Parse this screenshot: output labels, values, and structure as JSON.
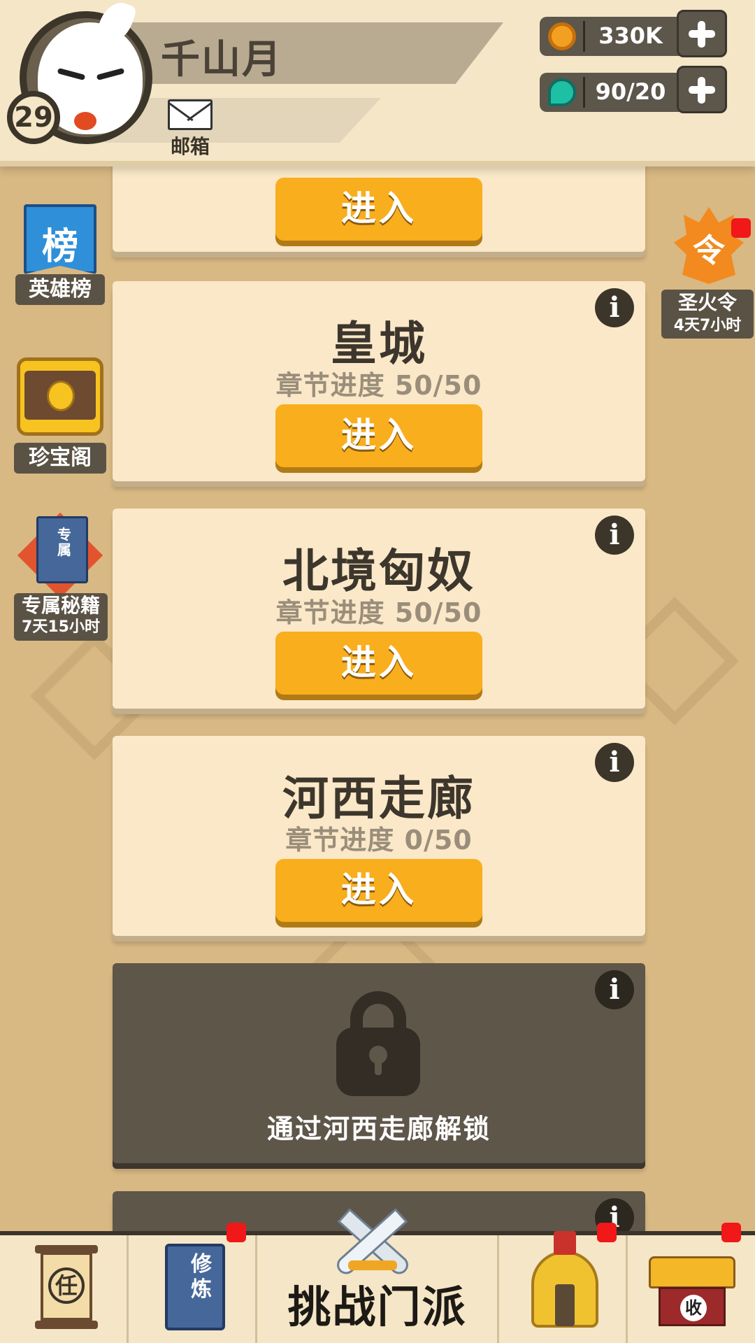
{
  "header": {
    "player_name": "千山月",
    "level": "29",
    "mail_label": "邮箱",
    "gold_value": "330K",
    "energy_value": "90/20",
    "gold_icon": "coin-icon",
    "energy_icon": "jade-icon"
  },
  "side_left": {
    "ranking_label": "英雄榜",
    "ranking_glyph": "榜",
    "treasure_label": "珍宝阁",
    "manual_label": "专属秘籍",
    "manual_timer": "7天15小时",
    "manual_glyph": "专属"
  },
  "side_right": {
    "token_label": "圣火令",
    "token_timer": "4天7小时",
    "token_glyph": "令"
  },
  "cards": [
    {
      "enter_label": "进入"
    },
    {
      "title": "皇城",
      "progress": "章节进度 50/50",
      "enter_label": "进入",
      "info": "i"
    },
    {
      "title": "北境匈奴",
      "progress": "章节进度 50/50",
      "enter_label": "进入",
      "info": "i"
    },
    {
      "title": "河西走廊",
      "progress": "章节进度 0/50",
      "enter_label": "进入",
      "info": "i"
    },
    {
      "locked_text": "通过河西走廊解锁",
      "info": "i"
    },
    {
      "info": "i"
    }
  ],
  "bottom_nav": {
    "task_glyph": "任",
    "train_glyph_1": "修",
    "train_glyph_2": "炼",
    "challenge_label": "挑战门派",
    "collect_glyph": "收"
  },
  "colors": {
    "accent": "#f9ae1d",
    "badge_red": "#f01818",
    "card_bg": "#fae8c8",
    "locked_bg": "#5e5649"
  }
}
